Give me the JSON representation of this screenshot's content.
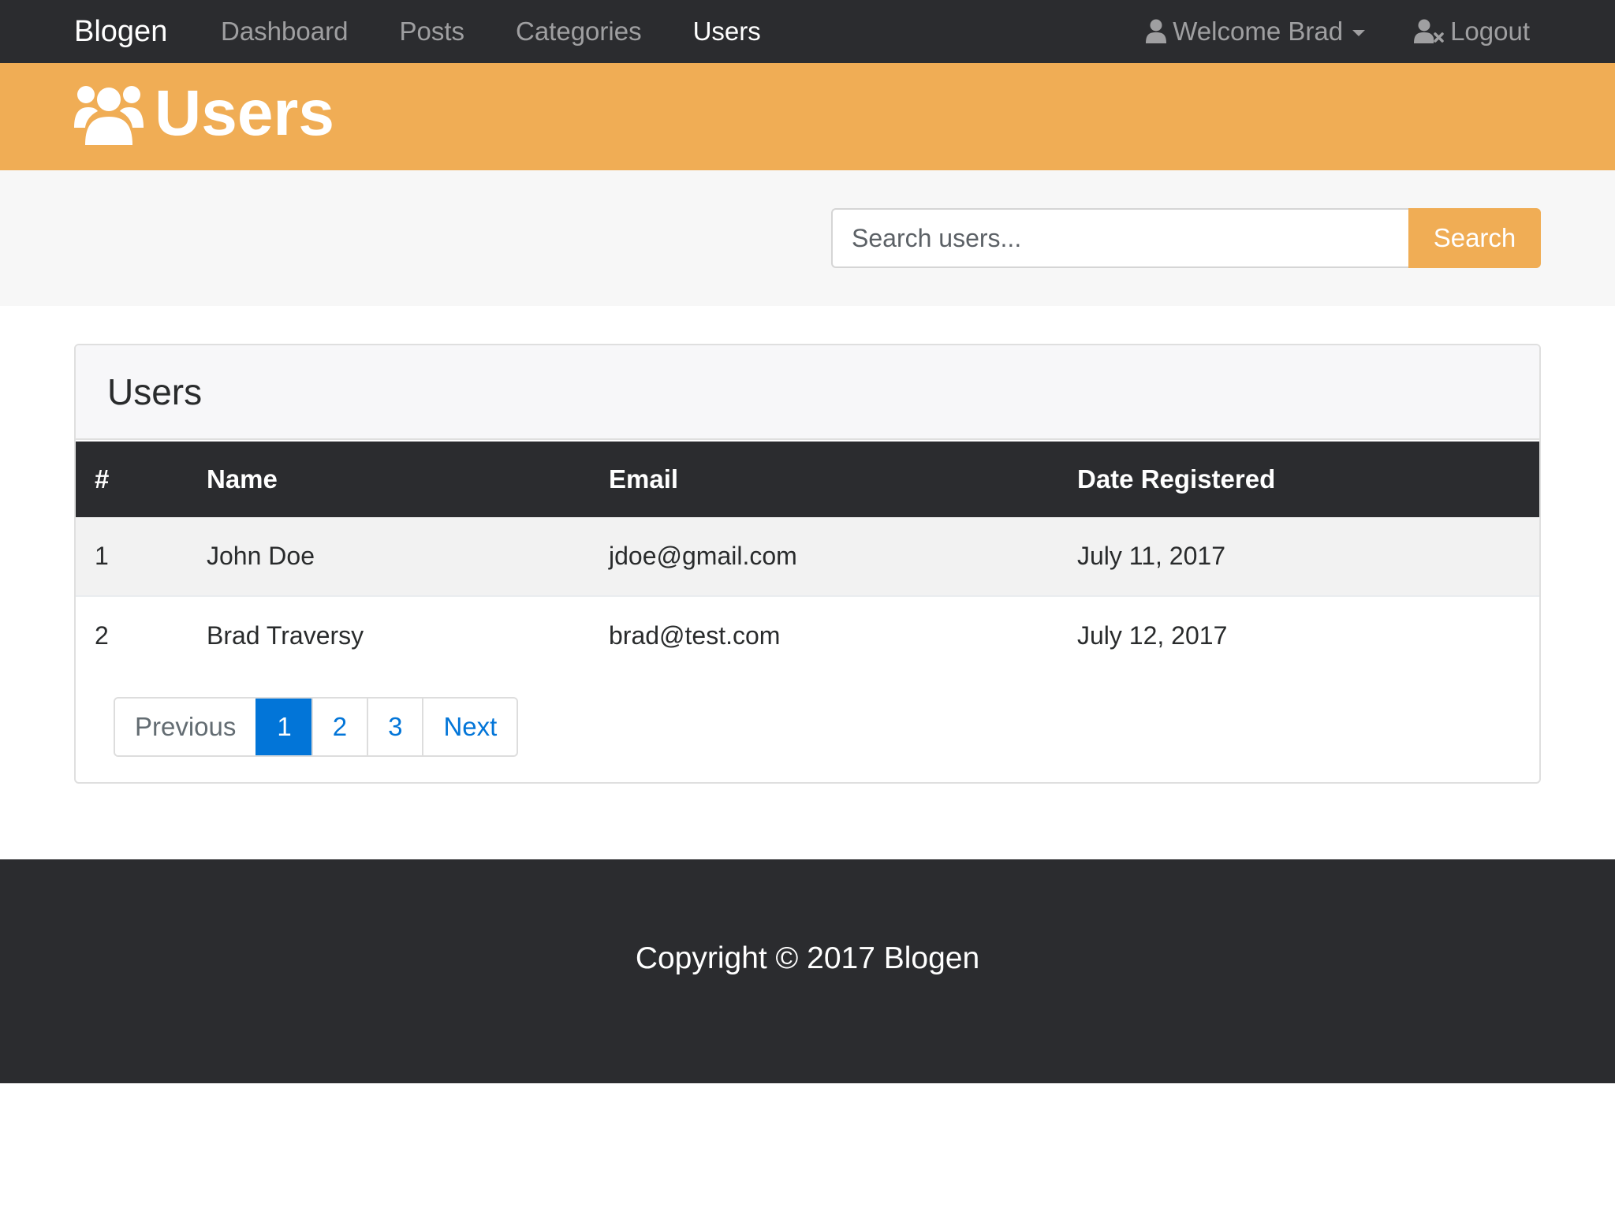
{
  "navbar": {
    "brand": "Blogen",
    "links": [
      {
        "label": "Dashboard"
      },
      {
        "label": "Posts"
      },
      {
        "label": "Categories"
      },
      {
        "label": "Users"
      }
    ],
    "welcome": "Welcome Brad",
    "logout": "Logout"
  },
  "header": {
    "title": "Users",
    "icon": "users-icon"
  },
  "search": {
    "placeholder": "Search users...",
    "button": "Search"
  },
  "card": {
    "title": "Users",
    "table": {
      "columns": [
        "#",
        "Name",
        "Email",
        "Date Registered"
      ],
      "rows": [
        {
          "num": "1",
          "name": "John Doe",
          "email": "jdoe@gmail.com",
          "date": "July 11, 2017"
        },
        {
          "num": "2",
          "name": "Brad Traversy",
          "email": "brad@test.com",
          "date": "July 12, 2017"
        }
      ]
    },
    "pagination": {
      "previous": "Previous",
      "pages": [
        "1",
        "2",
        "3"
      ],
      "next": "Next"
    }
  },
  "footer": {
    "copyright": "Copyright © 2017 Blogen"
  },
  "colors": {
    "navbar": "#2b2c2f",
    "accent": "#f0ad55",
    "primary": "#0275d8"
  }
}
